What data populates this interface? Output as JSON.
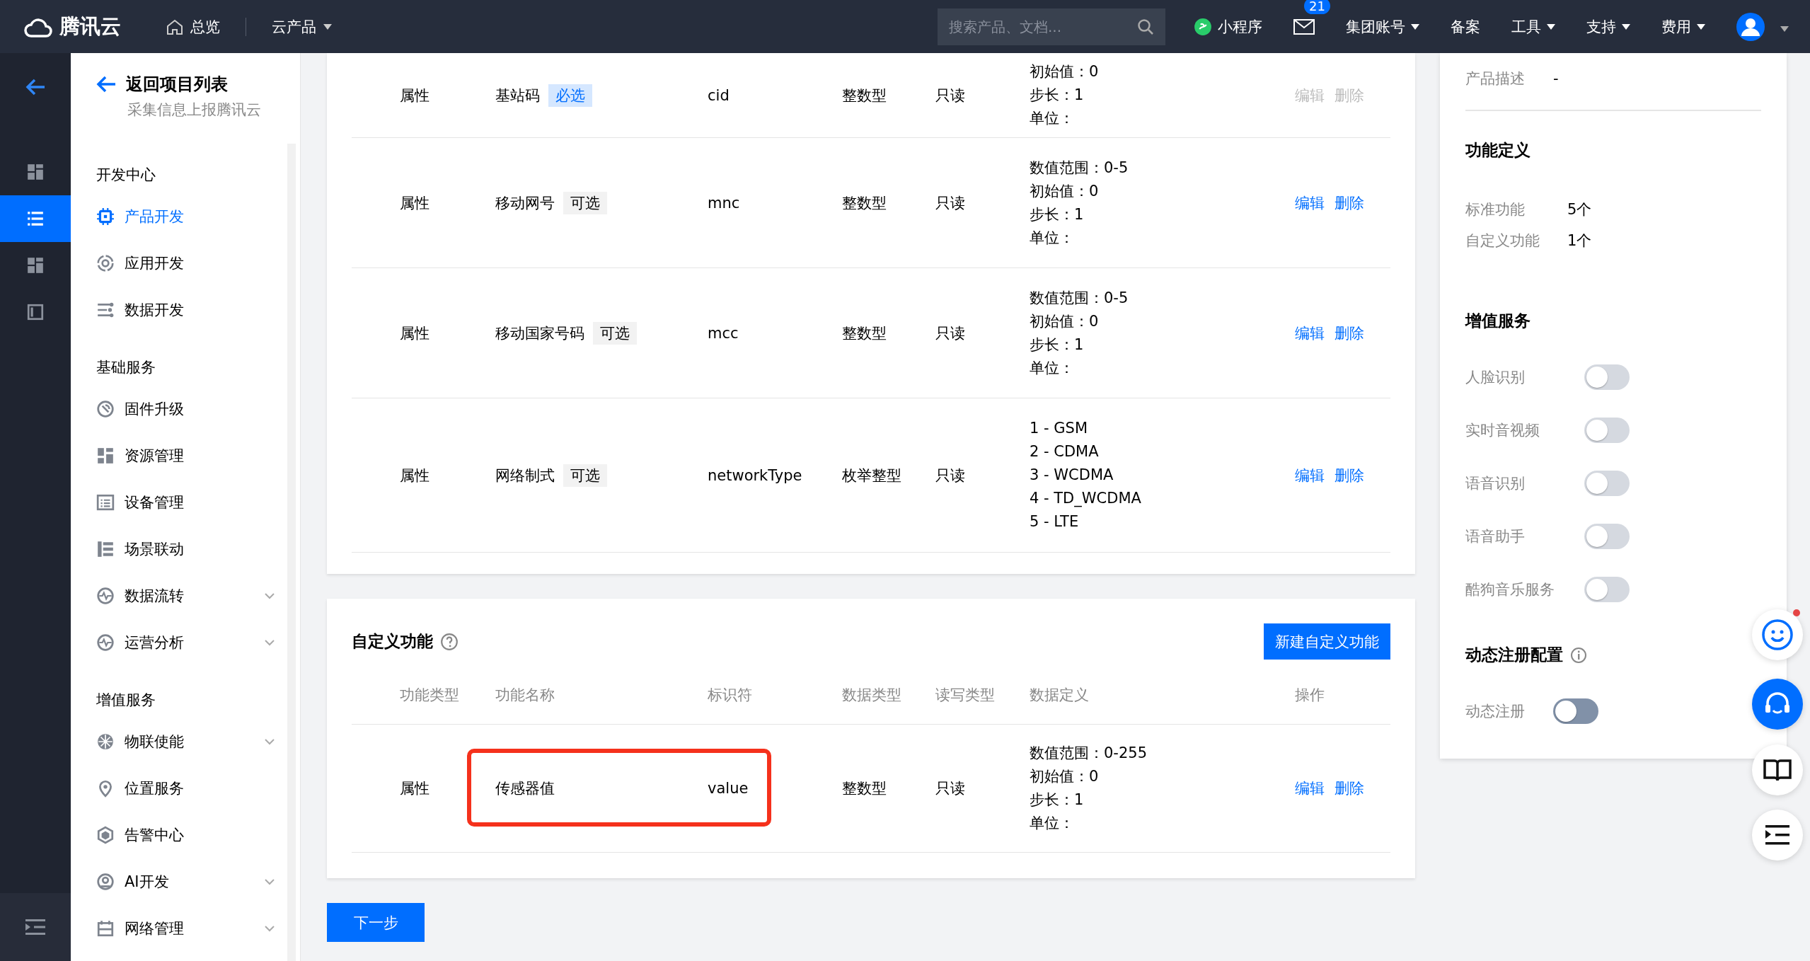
{
  "header": {
    "brand": "腾讯云",
    "nav": [
      {
        "kind": "home",
        "label": "总览"
      },
      {
        "kind": "dropdown",
        "label": "云产品"
      }
    ],
    "search": {
      "placeholder": "搜索产品、文档..."
    },
    "tools": [
      {
        "kind": "miniprogram",
        "label": "小程序"
      },
      {
        "kind": "mail",
        "badge": "21"
      },
      {
        "kind": "dropdown",
        "label": "集团账号"
      },
      {
        "kind": "plain",
        "label": "备案"
      },
      {
        "kind": "dropdown",
        "label": "工具"
      },
      {
        "kind": "dropdown",
        "label": "支持"
      },
      {
        "kind": "dropdown",
        "label": "费用"
      },
      {
        "kind": "avatar"
      }
    ]
  },
  "rail": {
    "items": [
      {
        "selected": false
      },
      {
        "selected": true
      },
      {
        "selected": false
      },
      {
        "selected": false
      }
    ]
  },
  "sidebar": {
    "back": {
      "title": "返回项目列表",
      "subtitle": "采集信息上报腾讯云"
    },
    "groups": [
      {
        "title": "开发中心",
        "items": [
          {
            "label": "产品开发",
            "selected": true,
            "expandable": false
          },
          {
            "label": "应用开发",
            "selected": false,
            "expandable": false
          },
          {
            "label": "数据开发",
            "selected": false,
            "expandable": false
          }
        ]
      },
      {
        "title": "基础服务",
        "items": [
          {
            "label": "固件升级",
            "selected": false,
            "expandable": false
          },
          {
            "label": "资源管理",
            "selected": false,
            "expandable": false
          },
          {
            "label": "设备管理",
            "selected": false,
            "expandable": false
          },
          {
            "label": "场景联动",
            "selected": false,
            "expandable": false
          },
          {
            "label": "数据流转",
            "selected": false,
            "expandable": true
          },
          {
            "label": "运营分析",
            "selected": false,
            "expandable": true
          }
        ]
      },
      {
        "title": "增值服务",
        "items": [
          {
            "label": "物联使能",
            "selected": false,
            "expandable": true
          },
          {
            "label": "位置服务",
            "selected": false,
            "expandable": false
          },
          {
            "label": "告警中心",
            "selected": false,
            "expandable": false
          },
          {
            "label": "AI开发",
            "selected": false,
            "expandable": true
          },
          {
            "label": "网络管理",
            "selected": false,
            "expandable": true
          }
        ]
      }
    ]
  },
  "standard_table": {
    "rows": [
      {
        "type": "属性",
        "name": "基站码",
        "tag": {
          "label": "必选",
          "required": true
        },
        "identifier": "cid",
        "data_type": "整数型",
        "access": "只读",
        "definition": [
          "初始值：0",
          "步长：1",
          "单位："
        ],
        "actions": [
          {
            "label": "编辑",
            "disabled": true
          },
          {
            "label": "删除",
            "disabled": true
          }
        ]
      },
      {
        "type": "属性",
        "name": "移动网号",
        "tag": {
          "label": "可选",
          "required": false
        },
        "identifier": "mnc",
        "data_type": "整数型",
        "access": "只读",
        "definition": [
          "数值范围：0-5",
          "初始值：0",
          "步长：1",
          "单位："
        ],
        "actions": [
          {
            "label": "编辑",
            "disabled": false
          },
          {
            "label": "删除",
            "disabled": false
          }
        ]
      },
      {
        "type": "属性",
        "name": "移动国家号码",
        "tag": {
          "label": "可选",
          "required": false
        },
        "identifier": "mcc",
        "data_type": "整数型",
        "access": "只读",
        "definition": [
          "数值范围：0-5",
          "初始值：0",
          "步长：1",
          "单位："
        ],
        "actions": [
          {
            "label": "编辑",
            "disabled": false
          },
          {
            "label": "删除",
            "disabled": false
          }
        ]
      },
      {
        "type": "属性",
        "name": "网络制式",
        "tag": {
          "label": "可选",
          "required": false
        },
        "identifier": "networkType",
        "data_type": "枚举整型",
        "access": "只读",
        "definition": [
          "1 - GSM",
          "2 - CDMA",
          "3 - WCDMA",
          "4 - TD_WCDMA",
          "5 - LTE"
        ],
        "actions": [
          {
            "label": "编辑",
            "disabled": false
          },
          {
            "label": "删除",
            "disabled": false
          }
        ]
      }
    ]
  },
  "custom_section": {
    "title": "自定义功能",
    "new_button": "新建自定义功能",
    "columns": [
      "功能类型",
      "功能名称",
      "标识符",
      "数据类型",
      "读写类型",
      "数据定义",
      "操作"
    ],
    "rows": [
      {
        "type": "属性",
        "name": "传感器值",
        "identifier": "value",
        "data_type": "整数型",
        "access": "只读",
        "definition": [
          "数值范围：0-255",
          "初始值：0",
          "步长：1",
          "单位："
        ],
        "actions": [
          {
            "label": "编辑",
            "disabled": false
          },
          {
            "label": "删除",
            "disabled": false
          }
        ],
        "highlighted": true
      }
    ]
  },
  "next_button": "下一步",
  "right_panel": {
    "description": {
      "label": "产品描述",
      "value": "-"
    },
    "function_definition": {
      "title": "功能定义",
      "items": [
        {
          "label": "标准功能",
          "value": "5个"
        },
        {
          "label": "自定义功能",
          "value": "1个"
        }
      ]
    },
    "value_added": {
      "title": "增值服务",
      "services": [
        {
          "label": "人脸识别",
          "on": false,
          "disabled": true
        },
        {
          "label": "实时音视频",
          "on": false,
          "disabled": true
        },
        {
          "label": "语音识别",
          "on": false,
          "disabled": true
        },
        {
          "label": "语音助手",
          "on": false,
          "disabled": true
        },
        {
          "label": "酷狗音乐服务",
          "on": false,
          "disabled": true
        }
      ]
    },
    "dynamic_registration": {
      "title": "动态注册配置",
      "label": "动态注册",
      "on": false,
      "disabled": false
    }
  }
}
